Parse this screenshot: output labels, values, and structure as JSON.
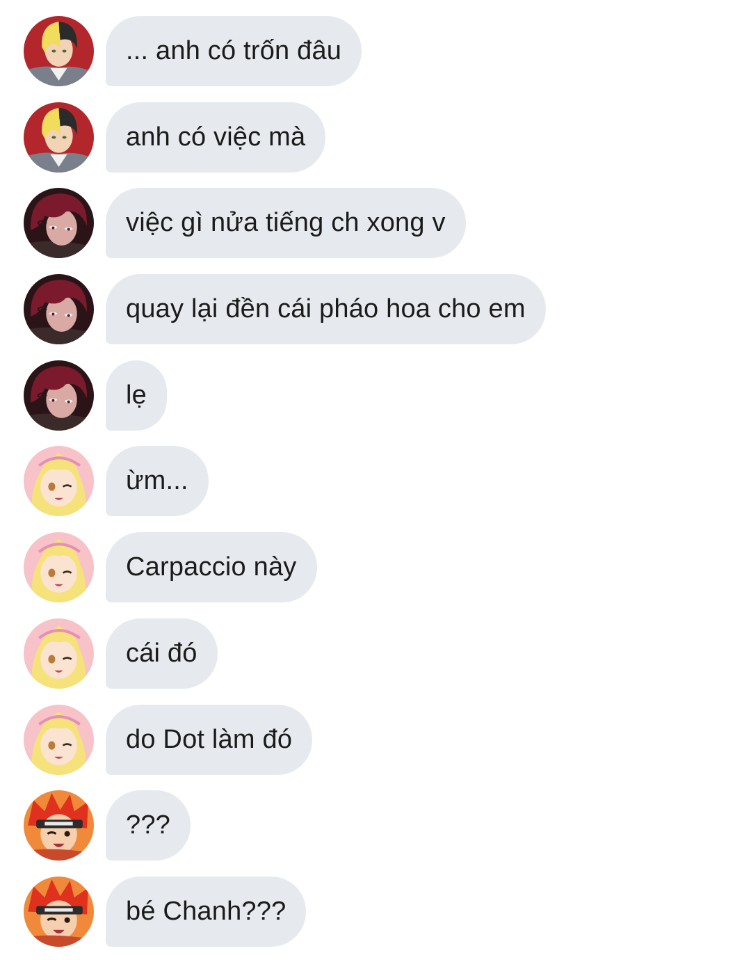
{
  "messages": [
    {
      "sender": "blonde-black-haired-man",
      "text": "... anh có trốn đâu"
    },
    {
      "sender": "blonde-black-haired-man",
      "text": "anh có việc mà"
    },
    {
      "sender": "red-haired-man",
      "text": "việc gì nửa tiếng ch xong v"
    },
    {
      "sender": "red-haired-man",
      "text": "quay lại đền cái pháo hoa cho em"
    },
    {
      "sender": "red-haired-man",
      "text": "lẹ"
    },
    {
      "sender": "blonde-girl",
      "text": "ừm..."
    },
    {
      "sender": "blonde-girl",
      "text": "Carpaccio này"
    },
    {
      "sender": "blonde-girl",
      "text": "cái đó"
    },
    {
      "sender": "blonde-girl",
      "text": "do Dot làm đó"
    },
    {
      "sender": "orange-haired-boy",
      "text": "???"
    },
    {
      "sender": "orange-haired-boy",
      "text": "bé Chanh???"
    }
  ],
  "colors": {
    "background": "#ffffff",
    "bubble": "#e6eaee",
    "text": "#1b1b1b"
  }
}
